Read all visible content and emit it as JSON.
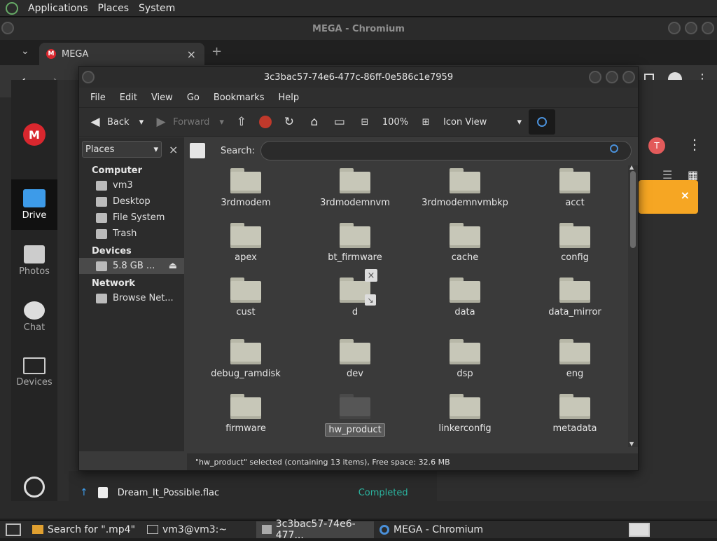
{
  "top_panel": {
    "items": [
      "Applications",
      "Places",
      "System"
    ]
  },
  "chromium": {
    "title": "MEGA - Chromium",
    "tab": {
      "label": "MEGA",
      "close": "×",
      "new": "+"
    }
  },
  "mega": {
    "rail": [
      {
        "label": "Drive"
      },
      {
        "label": "Photos"
      },
      {
        "label": "Chat"
      },
      {
        "label": "Devices"
      }
    ],
    "avatar": "T",
    "transfer": {
      "file": "Dream_It_Possible.flac",
      "status": "Completed"
    }
  },
  "nautilus": {
    "title": "3c3bac57-74e6-477c-86ff-0e586c1e7959",
    "menu": [
      "File",
      "Edit",
      "View",
      "Go",
      "Bookmarks",
      "Help"
    ],
    "toolbar": {
      "back": "Back",
      "forward": "Forward",
      "zoom": "100%",
      "view_mode": "Icon View"
    },
    "sidebar": {
      "selector": "Places",
      "sections": [
        {
          "head": "Computer",
          "items": [
            "vm3",
            "Desktop",
            "File System",
            "Trash"
          ]
        },
        {
          "head": "Devices",
          "items": [
            "5.8 GB ..."
          ]
        },
        {
          "head": "Network",
          "items": [
            "Browse Net..."
          ]
        }
      ]
    },
    "search": {
      "label": "Search:",
      "value": ""
    },
    "folders": [
      "3rdmodem",
      "3rdmodemnvm",
      "3rdmodemnvmbkp",
      "acct",
      "apex",
      "bt_firmware",
      "cache",
      "config",
      "cust",
      "d",
      "data",
      "data_mirror",
      "debug_ramdisk",
      "dev",
      "dsp",
      "eng",
      "firmware",
      "hw_product",
      "linkerconfig",
      "metadata"
    ],
    "selected": "hw_product",
    "status": "\"hw_product\" selected (containing 13 items), Free space: 32.6 MB"
  },
  "taskbar": {
    "tasks": [
      "Search for \".mp4\"",
      "vm3@vm3:~",
      "3c3bac57-74e6-477...",
      "MEGA - Chromium"
    ]
  }
}
